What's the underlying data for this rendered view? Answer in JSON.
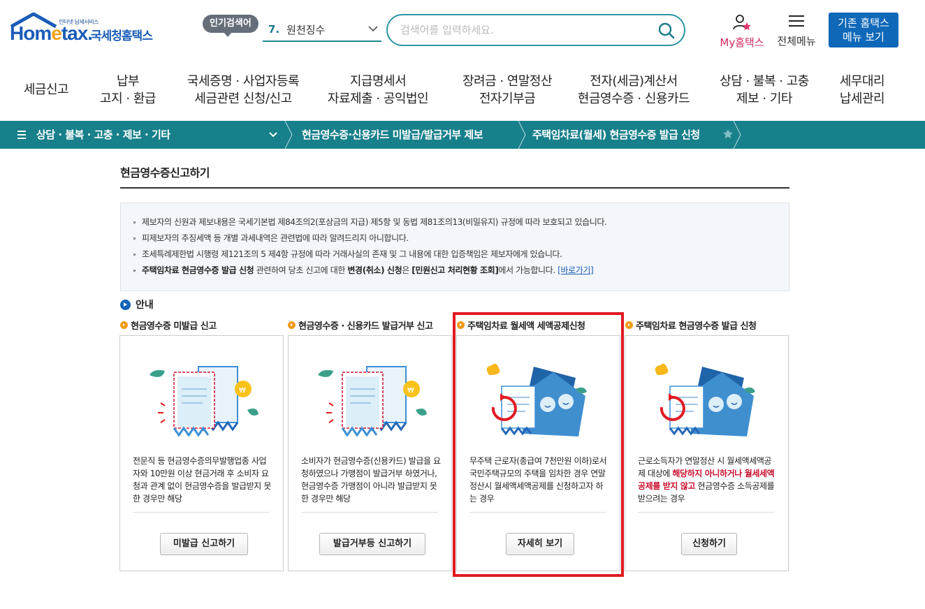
{
  "header": {
    "logo_tag": "인터넷 납세서비스",
    "logo_home": "Hom",
    "logo_e": "e",
    "logo_tax": "tax.",
    "logo_kr": "국세청홈택스",
    "popular_badge": "인기검색어",
    "popular_rank": "7.",
    "popular_term": "원천징수",
    "search_placeholder": "검색어를 입력하세요.",
    "my_hometax": "My홈택스",
    "all_menu": "전체메뉴",
    "legacy_line1": "기존 홈택스",
    "legacy_line2": "메뉴 보기"
  },
  "gnb": [
    {
      "line1": "세금신고",
      "line2": ""
    },
    {
      "line1": "납부",
      "line2": "고지 · 환급"
    },
    {
      "line1": "국세증명 · 사업자등록",
      "line2": "세금관련 신청/신고"
    },
    {
      "line1": "지급명세서",
      "line2": "자료제출 · 공익법인"
    },
    {
      "line1": "장려금 · 연말정산",
      "line2": "전자기부금"
    },
    {
      "line1": "전자(세금)계산서",
      "line2": "현금영수증 · 신용카드"
    },
    {
      "line1": "상담 · 불복 · 고충",
      "line2": "제보 · 기타"
    },
    {
      "line1": "세무대리",
      "line2": "납세관리"
    }
  ],
  "breadcrumb": {
    "level1": "상담 · 불복 · 고충 · 제보 · 기타",
    "level2": "현금영수증·신용카드 미발급/발급거부 제보",
    "level3": "주택임차료(월세) 현금영수증 발급 신청"
  },
  "page_title": "현금영수증신고하기",
  "notice": {
    "item1": "제보자의 신원과 제보내용은 국세기본법 제84조의2(포상금의 지급) 제5항 및 동법 제81조의13(비밀유지) 규정에 따라 보호되고 있습니다.",
    "item2": "피제보자의 추징세액 등 개별 과세내역은 관련법에 따라 알려드리지 아니합니다.",
    "item3": "조세특례제한법 시행령 제121조의 5 제4항 규정에 따라 거래사실의 존재 및 그 내용에 대한 입증책임은 제보자에게 있습니다.",
    "item4_b1": "주택임차료 현금영수증 발급 신청",
    "item4_t1": " 관련하여 당초 신고에 대한 ",
    "item4_b2": "변경(취소) 신청",
    "item4_t2": "은 ",
    "item4_b3": "[민원신고 처리현황 조회]",
    "item4_t3": "에서 가능합니다. ",
    "item4_link": "[바로가기]"
  },
  "guide_label": "안내",
  "cards": [
    {
      "heading": "현금영수증 미발급 신고",
      "desc": "전문직 등 현금영수증의무발행업종 사업자와 10만원 이상 현금거래 후 소비자 요청과 관계 없이 현금영수증을 발급받지 못한 경우만 해당",
      "button": "미발급 신고하기"
    },
    {
      "heading": "현금영수증 · 신용카드 발급거부 신고",
      "desc": "소비자가 현금영수증(신용카드) 발급을 요청하였으나 가맹점이 발급거부 하였거나, 현금영수증 가맹점이 아니라 발급받지 못한 경우만 해당",
      "button": "발급거부등 신고하기"
    },
    {
      "heading": "주택임차료 월세액 세액공제신청",
      "desc": "무주택 근로자(총급여 7천만원 이하)로서 국민주택규모의 주택을 임차한 경우 연말정산시 월세액세액공제를 신청하고자 하는 경우",
      "button": "자세히 보기"
    },
    {
      "heading": "주택임차료 현금영수증 발급 신청",
      "desc_a": "근로소득자가 연말정산 시 월세액세액공제 대상에 ",
      "desc_red": "해당하지 아니하거나 월세세액공제를 받지 않고",
      "desc_b": " 현금영수증 소득공제를 받으려는 경우",
      "button": "신청하기"
    }
  ],
  "colors": {
    "brand_teal": "#17808b",
    "brand_blue": "#0f68b8",
    "highlight_red": "#e11a22"
  }
}
